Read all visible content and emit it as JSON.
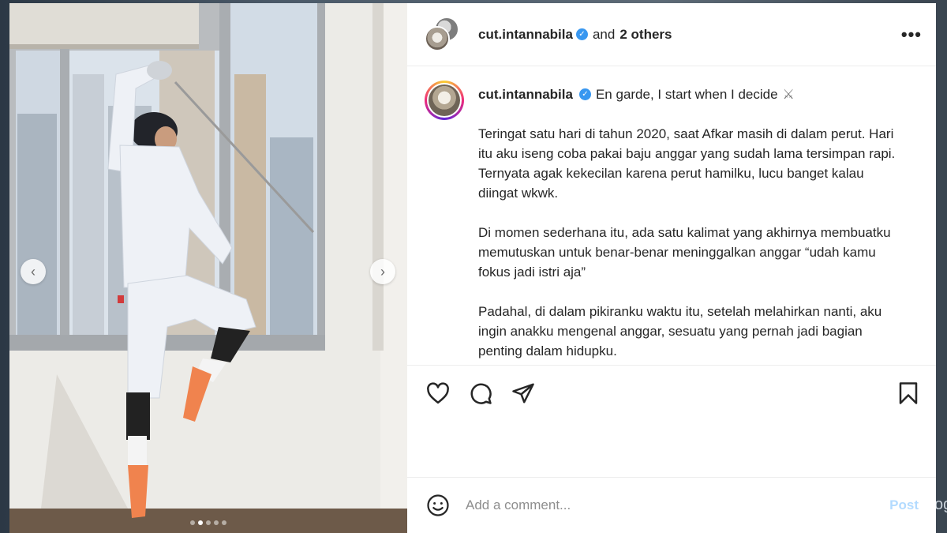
{
  "backdrop": {
    "edge_text": "og"
  },
  "media": {
    "prev_glyph": "‹",
    "next_glyph": "›",
    "slides_total": 5,
    "slide_active_index": 1
  },
  "header": {
    "username": "cut.intannabila",
    "verified_glyph": "✓",
    "and_text": "and",
    "others_text": "2 others",
    "more_glyph": "•••"
  },
  "caption": {
    "username": "cut.intannabila",
    "first_line": "En garde, I start when I decide",
    "first_line_emoji": "⚔",
    "paragraphs": [
      "Teringat satu hari di tahun 2020, saat Afkar masih di dalam perut. Hari itu aku iseng coba pakai baju anggar yang sudah lama tersimpan rapi. Ternyata agak kekecilan karena perut hamilku, lucu banget kalau diingat wkwk.",
      "Di momen sederhana itu, ada satu kalimat yang akhirnya membuatku memutuskan untuk benar-benar meninggalkan anggar “udah kamu fokus jadi istri aja”",
      "Padahal, di dalam pikiranku waktu itu, setelah melahirkan nanti, aku ingin anakku mengenal anggar, sesuatu yang pernah jadi bagian penting dalam hidupku."
    ]
  },
  "actions": {
    "icons": [
      "heart-icon",
      "comment-icon",
      "share-icon",
      "bookmark-icon"
    ]
  },
  "comment": {
    "placeholder": "Add a comment...",
    "post_label": "Post",
    "emoji_icon": "smiley-icon"
  },
  "colors": {
    "verified": "#3897f0",
    "post_disabled": "#b3dbff",
    "shoe": "#f0834e",
    "text": "#262626",
    "placeholder": "#8e8e8e"
  }
}
